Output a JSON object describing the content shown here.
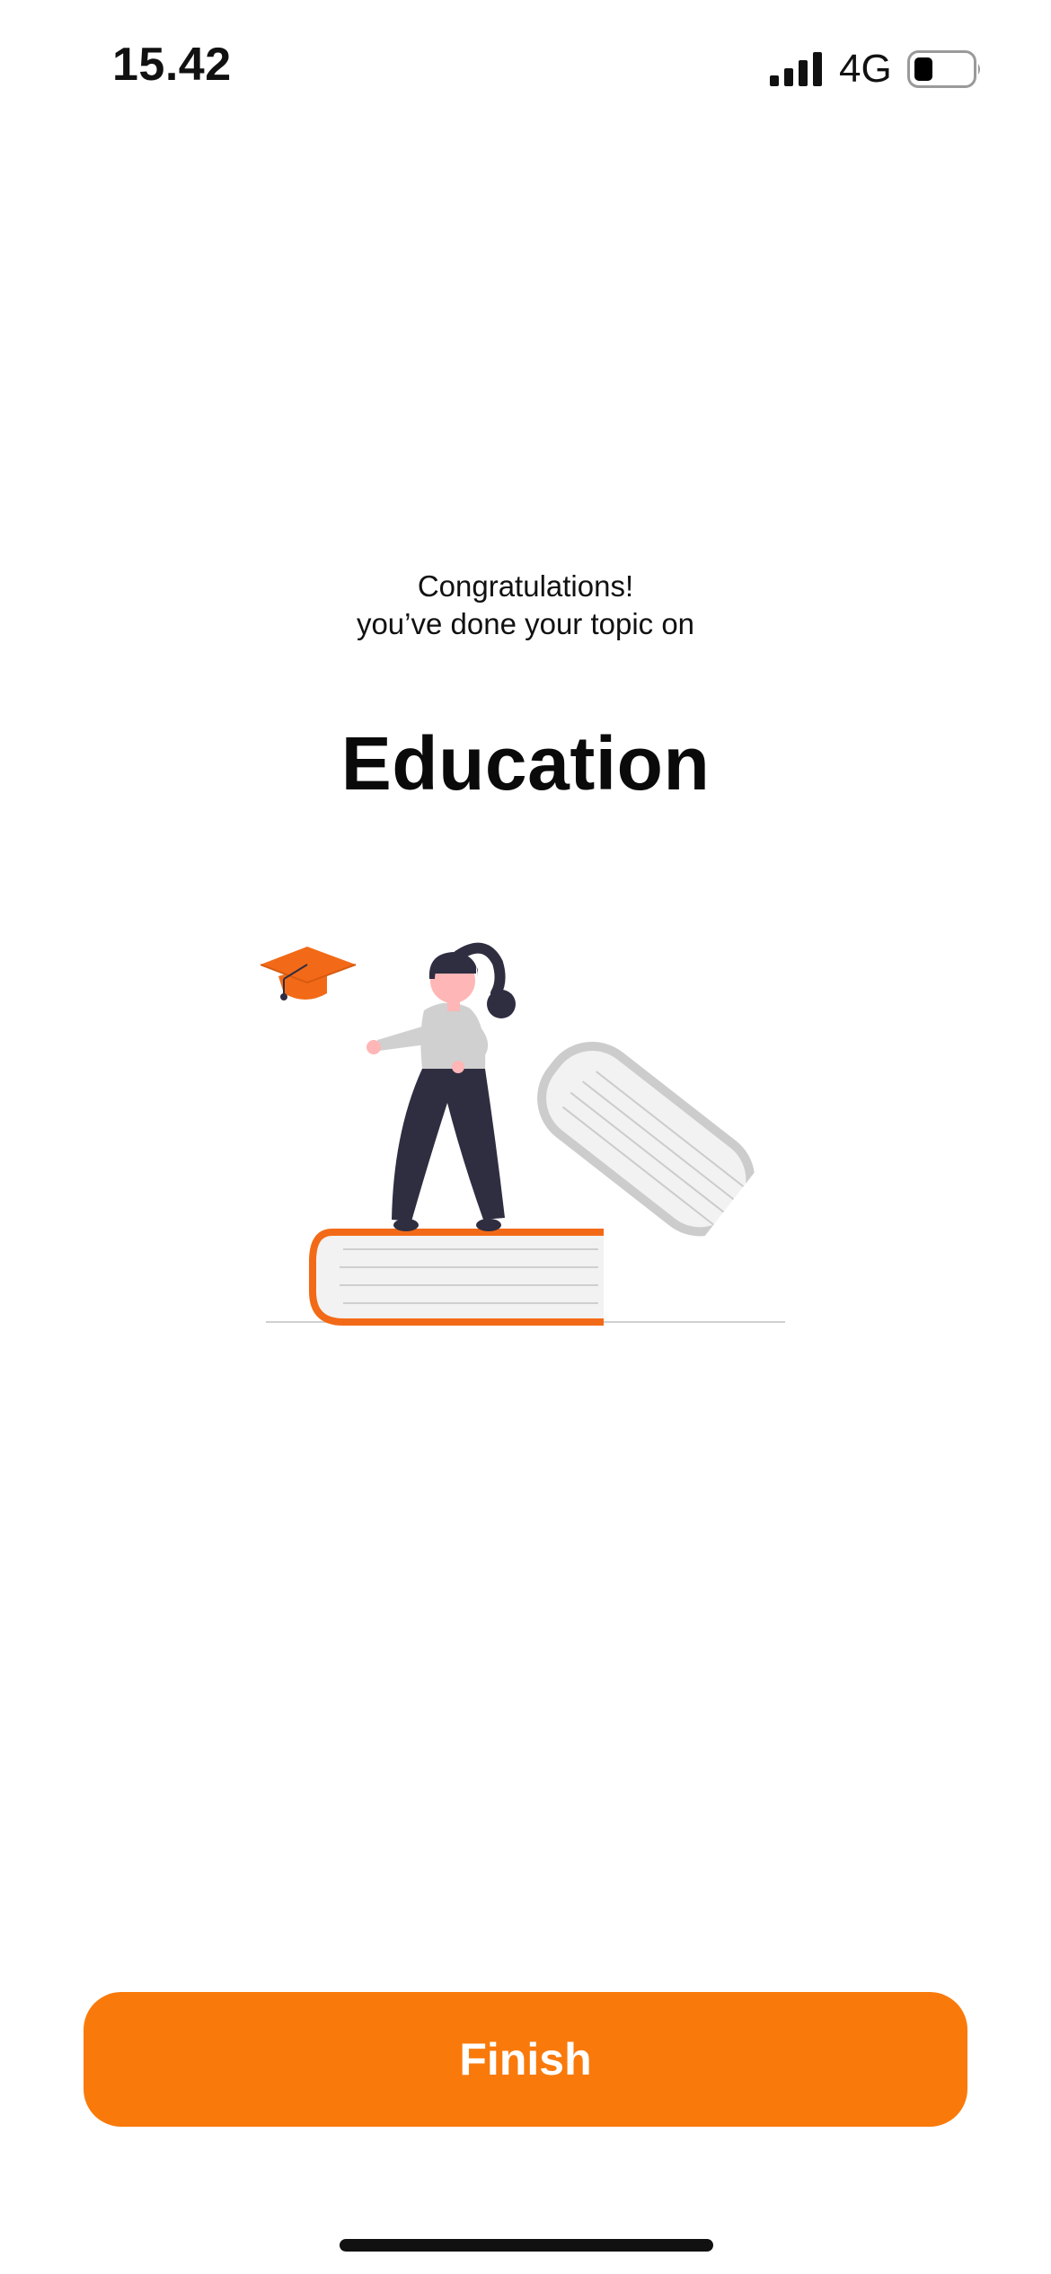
{
  "status_bar": {
    "time": "15.42",
    "network": "4G",
    "signal_icon": "cellular-signal-icon",
    "battery_icon": "battery-low-icon"
  },
  "content": {
    "congrats_line": "Congratulations!",
    "topic_line": "you’ve done your topic on",
    "topic_title": "Education",
    "illustration": "graduation-illustration"
  },
  "actions": {
    "finish_label": "Finish"
  },
  "colors": {
    "accent": "#f97a0b",
    "book_orange": "#f26a17",
    "figure_dark": "#2f2e41",
    "book_gray": "#cccccc",
    "paper": "#f2f2f2"
  }
}
